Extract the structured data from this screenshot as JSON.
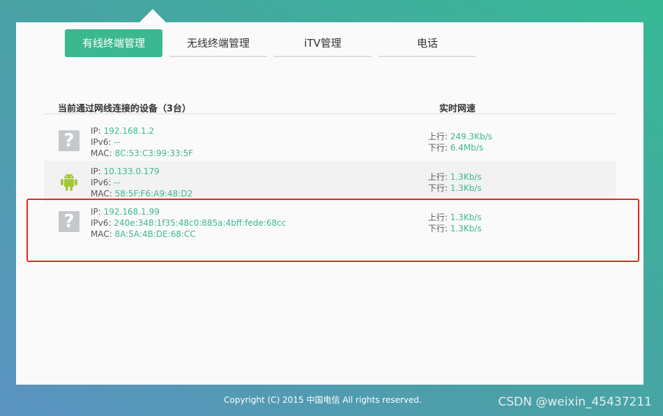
{
  "tabs": [
    {
      "label": "有线终端管理",
      "active": true
    },
    {
      "label": "无线终端管理"
    },
    {
      "label": "iTV管理"
    },
    {
      "label": "电话"
    }
  ],
  "table": {
    "device_header": "当前通过网线连接的设备（3台）",
    "speed_header": "实时网速"
  },
  "labels": {
    "ip": "IP: ",
    "ipv6": "IPv6: ",
    "mac": "MAC: ",
    "up": "上行: ",
    "down": "下行: "
  },
  "devices": [
    {
      "icon": "unknown-device-icon",
      "ip": "192.168.1.2",
      "ipv6": "--",
      "mac": "8C:53:C3:99:33:5F",
      "up": "249.3Kb/s",
      "down": "6.4Mb/s"
    },
    {
      "icon": "android-icon",
      "ip": "10.133.0.179",
      "ipv6": "--",
      "mac": "58:5F:F6:A9:48:D2",
      "up": "1.3Kb/s",
      "down": "1.3Kb/s"
    },
    {
      "icon": "unknown-device-icon",
      "ip": "192.168.1.99",
      "ipv6": "240e:348:1f35:48c0:885a:4bff:fede:68cc",
      "mac": "8A:5A:4B:DE:68:CC",
      "up": "1.3Kb/s",
      "down": "1.3Kb/s"
    }
  ],
  "icon_glyph": "?",
  "footer": "Copyright (C) 2015 中国电信 All rights reserved.",
  "watermark": "CSDN @weixin_45437211",
  "colors": {
    "accent": "#3cb890",
    "highlight": "#ee2222"
  }
}
